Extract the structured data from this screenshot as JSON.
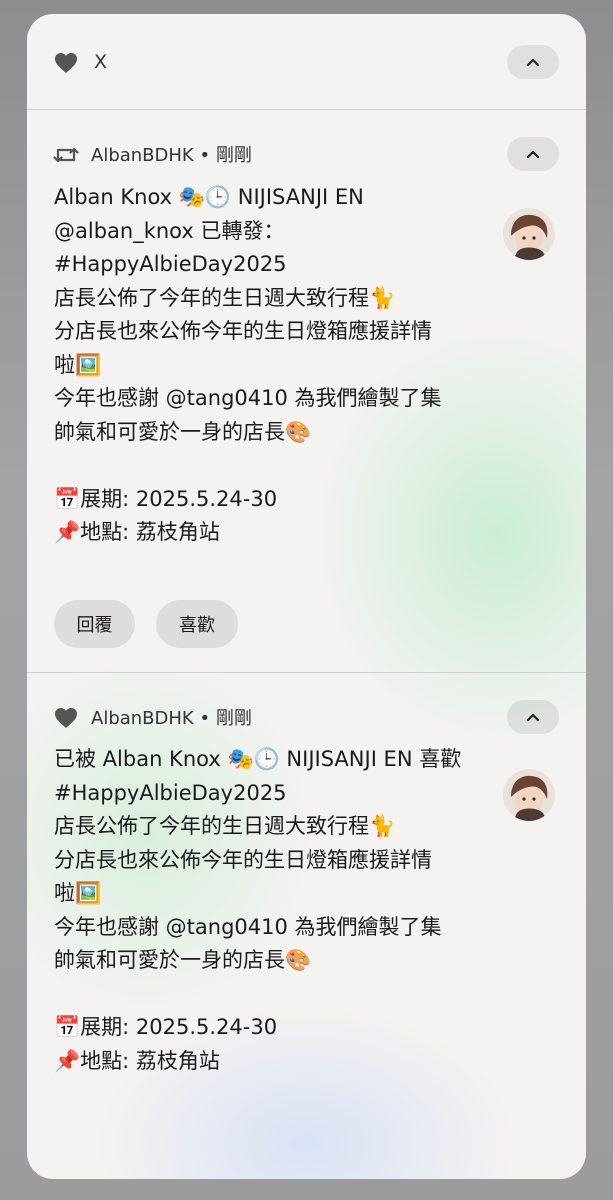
{
  "top_row": {
    "icon": "heart-icon",
    "label": "X"
  },
  "notification_repost": {
    "icon": "repost-icon",
    "account": "AlbanBDHK",
    "separator": "•",
    "time": "剛剛",
    "title": "Alban Knox 🎭🕒 NIJISANJI EN",
    "lines": [
      "@alban_knox 已轉發：",
      "#HappyAlbieDay2025",
      "店長公佈了今年的生日週大致行程🐈",
      "分店長也來公佈今年的生日燈箱應援詳情",
      "啦🖼️",
      "今年也感謝 @tang0410 為我們繪製了集",
      "帥氣和可愛於一身的店長🎨",
      "",
      "📅展期: 2025.5.24-30",
      "📌地點: 荔枝角站"
    ],
    "actions": {
      "reply": "回覆",
      "like": "喜歡"
    }
  },
  "notification_like": {
    "icon": "heart-icon",
    "account": "AlbanBDHK",
    "separator": "•",
    "time": "剛剛",
    "title": "已被 Alban Knox 🎭🕒 NIJISANJI EN 喜歡",
    "lines": [
      "#HappyAlbieDay2025",
      "店長公佈了今年的生日週大致行程🐈",
      "分店長也來公佈今年的生日燈箱應援詳情",
      "啦🖼️",
      "今年也感謝 @tang0410 為我們繪製了集",
      "帥氣和可愛於一身的店長🎨",
      "",
      "📅展期: 2025.5.24-30",
      "📌地點: 荔枝角站"
    ]
  },
  "colors": {
    "panel_bg": "#f4f3f1",
    "accent_green": "#c4ecd0",
    "text": "#1a1a1a",
    "icon": "#555555"
  }
}
